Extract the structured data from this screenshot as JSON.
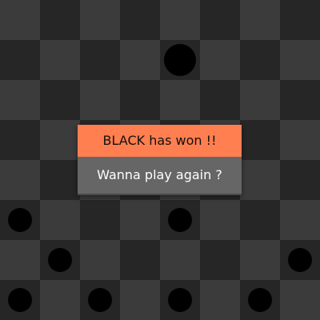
{
  "board": {
    "rows": 8,
    "cols": 8,
    "colors": {
      "light": "#3b3b3b",
      "dark": "#262626",
      "piece": "#000000"
    },
    "pieces": [
      {
        "row": 1,
        "col": 4,
        "color": "black",
        "king": true
      },
      {
        "row": 5,
        "col": 0,
        "color": "black",
        "king": false
      },
      {
        "row": 5,
        "col": 4,
        "color": "black",
        "king": false
      },
      {
        "row": 6,
        "col": 1,
        "color": "black",
        "king": false
      },
      {
        "row": 6,
        "col": 7,
        "color": "black",
        "king": false
      },
      {
        "row": 7,
        "col": 0,
        "color": "black",
        "king": false
      },
      {
        "row": 7,
        "col": 2,
        "color": "black",
        "king": false
      },
      {
        "row": 7,
        "col": 4,
        "color": "black",
        "king": false
      },
      {
        "row": 7,
        "col": 6,
        "color": "black",
        "king": false
      }
    ]
  },
  "dialog": {
    "title": "BLACK has won !!",
    "action_label": "Wanna play again ?",
    "accent_color": "#ff7f50",
    "action_color": "#666666"
  }
}
